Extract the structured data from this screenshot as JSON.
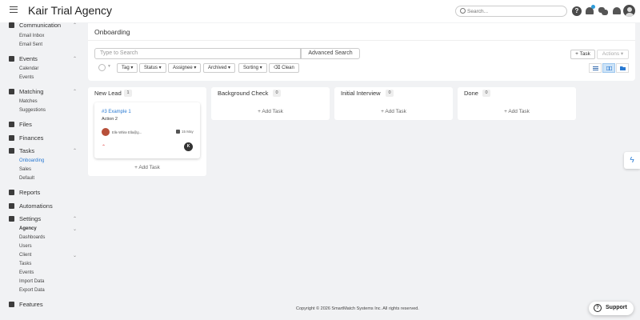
{
  "app": {
    "title": "Kair Trial Agency"
  },
  "search": {
    "placeholder": "Search..."
  },
  "sidebar": {
    "communication": {
      "label": "Communication",
      "items": [
        "Email Inbox",
        "Email Sent"
      ]
    },
    "events": {
      "label": "Events",
      "items": [
        "Calendar",
        "Events"
      ]
    },
    "matching": {
      "label": "Matching",
      "items": [
        "Matches",
        "Suggestions"
      ]
    },
    "files": {
      "label": "Files"
    },
    "finances": {
      "label": "Finances"
    },
    "tasks": {
      "label": "Tasks",
      "items": [
        "Onboarding",
        "Sales",
        "Default"
      ],
      "active": "Onboarding"
    },
    "reports": {
      "label": "Reports"
    },
    "automations": {
      "label": "Automations"
    },
    "settings": {
      "label": "Settings",
      "agency": {
        "label": "Agency",
        "items": [
          "Dashboards",
          "Users"
        ]
      },
      "client": {
        "label": "Client",
        "items": [
          "Tasks",
          "Events",
          "Import Data",
          "Export Data"
        ]
      }
    },
    "features": {
      "label": "Features"
    }
  },
  "page": {
    "title": "Onboarding"
  },
  "filters": {
    "search_placeholder": "Type to Search",
    "advanced_search": "Advanced Search",
    "buttons": [
      "Tag",
      "Status",
      "Assignee",
      "Archived",
      "Sorting"
    ],
    "clean": "Clean",
    "task_button": "Task",
    "actions_button": "Actions"
  },
  "columns": [
    {
      "name": "New Lead",
      "count": "1",
      "add_label": "Add Task"
    },
    {
      "name": "Background Check",
      "count": "0",
      "add_label": "Add Task"
    },
    {
      "name": "Initial Interview",
      "count": "0",
      "add_label": "Add Task"
    },
    {
      "name": "Done",
      "count": "0",
      "add_label": "Add Task"
    }
  ],
  "card": {
    "title": "#3 Example 1",
    "subtitle": "Action 2",
    "assignee": "Elle White Ella@g...",
    "date": "15 May",
    "badge": "K"
  },
  "footer": {
    "copyright": "Copyright © 2026 SmartMatch Systems Inc. All rights reserved."
  },
  "support": {
    "label": "Support"
  },
  "colors": {
    "accent": "#2a7ad2",
    "background": "#f1f2f4"
  }
}
